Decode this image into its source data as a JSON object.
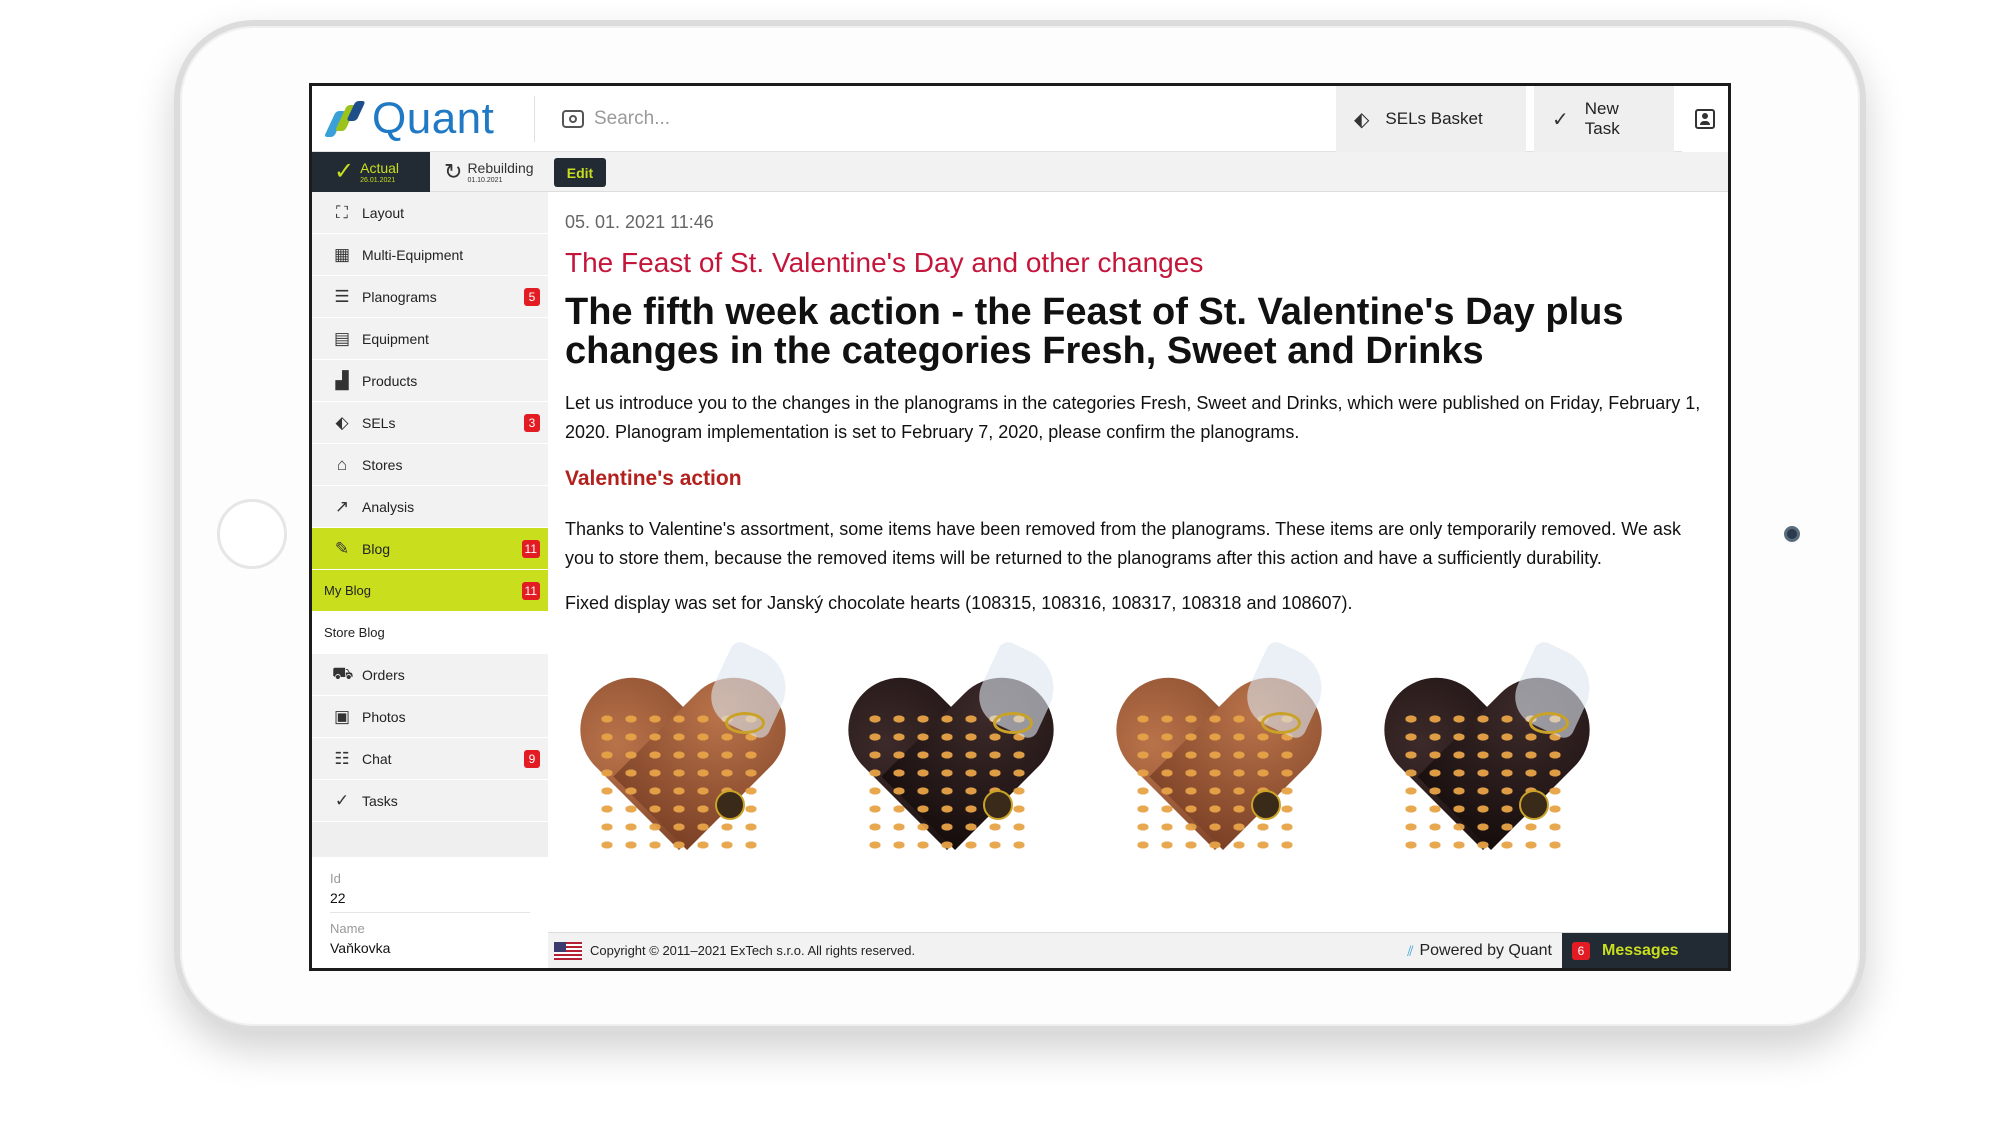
{
  "header": {
    "app_name": "Quant",
    "search_placeholder": "Search...",
    "sels_basket_label": "SELs Basket",
    "new_task_label": "New Task"
  },
  "toolbar": {
    "actual_label": "Actual",
    "actual_date": "26.01.2021",
    "rebuilding_label": "Rebuilding",
    "rebuilding_date": "01.10.2021",
    "edit_label": "Edit"
  },
  "sidebar": {
    "items": [
      {
        "label": "Layout",
        "icon": "layout-icon",
        "badge": ""
      },
      {
        "label": "Multi-Equipment",
        "icon": "multi-equipment-icon",
        "badge": ""
      },
      {
        "label": "Planograms",
        "icon": "planograms-icon",
        "badge": "5"
      },
      {
        "label": "Equipment",
        "icon": "equipment-icon",
        "badge": ""
      },
      {
        "label": "Products",
        "icon": "products-icon",
        "badge": ""
      },
      {
        "label": "SELs",
        "icon": "tag-icon",
        "badge": "3"
      },
      {
        "label": "Stores",
        "icon": "store-icon",
        "badge": ""
      },
      {
        "label": "Analysis",
        "icon": "analysis-icon",
        "badge": ""
      },
      {
        "label": "Blog",
        "icon": "edit-icon",
        "badge": "11"
      },
      {
        "label": "My Blog",
        "badge": "11"
      },
      {
        "label": "Store Blog",
        "badge": ""
      },
      {
        "label": "Orders",
        "icon": "orders-icon",
        "badge": ""
      },
      {
        "label": "Photos",
        "icon": "photo-icon",
        "badge": ""
      },
      {
        "label": "Chat",
        "icon": "chat-icon",
        "badge": "9"
      },
      {
        "label": "Tasks",
        "icon": "check-circle-icon",
        "badge": ""
      }
    ],
    "info": {
      "id_label": "Id",
      "id_value": "22",
      "name_label": "Name",
      "name_value": "Vaňkovka"
    }
  },
  "article": {
    "date": "05. 01. 2021 11:46",
    "subtitle": "The Feast of St. Valentine's Day and other changes",
    "title": "The fifth week action - the Feast of St. Valentine's Day plus changes in the categories Fresh, Sweet and Drinks",
    "intro": "Let us introduce you to the changes in the planograms in the categories Fresh, Sweet and Drinks, which were published on Friday, February 1, 2020. Planogram implementation is set to February 7, 2020, please confirm the planograms.",
    "section_title": "Valentine's action",
    "body": "Thanks to Valentine's assortment, some items have been removed from the planograms. These items are only temporarily removed. We ask you to store them, because the removed items will be returned to the planograms after this action and have a sufficiently durability.",
    "fixed_display": "Fixed display was set for Janský chocolate hearts (108315, 108316, 108317, 108318 and 108607).",
    "images": [
      "milk-chocolate-almond-heart",
      "dark-chocolate-almond-heart",
      "milk-chocolate-hazelnut-heart",
      "dark-chocolate-hazelnut-heart"
    ]
  },
  "footer": {
    "copyright": "Copyright © 2011–2021 ExTech s.r.o. All rights reserved.",
    "powered_by": "Powered by Quant",
    "messages_count": "6",
    "messages_label": "Messages"
  },
  "colors": {
    "accent_lime": "#c9df1e",
    "dark": "#222a33",
    "badge_red": "#e31b23",
    "subtitle_red": "#c4163b",
    "brand_blue": "#1f79c4"
  }
}
